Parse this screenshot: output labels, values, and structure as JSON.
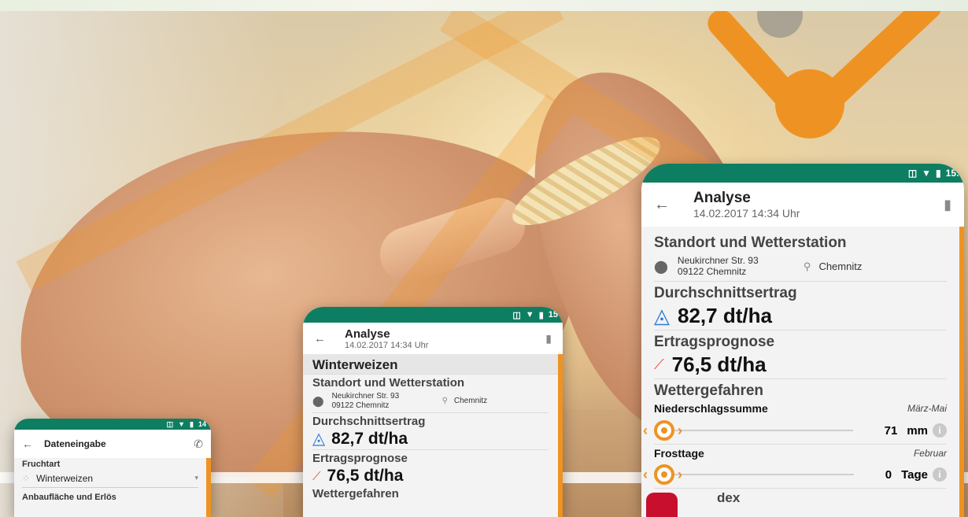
{
  "phone_main": {
    "status_time": "15:",
    "title": "Analyse",
    "subtitle": "14.02.2017 14:34 Uhr",
    "location_heading": "Standort und Wetterstation",
    "address_line1": "Neukirchner Str. 93",
    "address_line2": "09122 Chemnitz",
    "station": "Chemnitz",
    "yield_heading": "Durchschnittsertrag",
    "yield_value": "82,7 dt/ha",
    "forecast_heading": "Ertragsprognose",
    "forecast_value": "76,5 dt/ha",
    "hazards_heading": "Wettergefahren",
    "hazard1_label": "Niederschlagssumme",
    "hazard1_period": "März-Mai",
    "hazard1_value": "71",
    "hazard1_unit": "mm",
    "hazard2_label": "Frosttage",
    "hazard2_period": "Februar",
    "hazard2_value": "0",
    "hazard2_unit": "Tage",
    "partial_text": "dex"
  },
  "phone_middle": {
    "status_time": "15",
    "title": "Analyse",
    "subtitle": "14.02.2017 14:34 Uhr",
    "crop_heading": "Winterweizen",
    "location_heading": "Standort und Wetterstation",
    "address_line1": "Neukirchner Str. 93",
    "address_line2": "09122 Chemnitz",
    "station": "Chemnitz",
    "yield_heading": "Durchschnittsertrag",
    "yield_value": "82,7 dt/ha",
    "forecast_heading": "Ertragsprognose",
    "forecast_value": "76,5 dt/ha",
    "hazards_heading": "Wettergefahren"
  },
  "phone_left": {
    "status_time": "14",
    "title": "Dateneingabe",
    "crop_label": "Fruchtart",
    "crop_value": "Winterweizen",
    "area_label": "Anbaufläche und Erlös"
  },
  "colors": {
    "brand_green": "#0e7e62",
    "accent_orange": "#ee9323",
    "yield_blue": "#2b7bd8",
    "forecast_red": "#e0453d"
  },
  "icons": [
    "back-arrow-icon",
    "trash-icon",
    "location-pin-icon",
    "weather-station-icon",
    "yield-curve-icon",
    "forecast-trend-icon",
    "info-icon",
    "phone-icon",
    "wheat-icon",
    "dropdown-caret-icon",
    "vibrate-icon",
    "wifi-icon",
    "battery-icon"
  ]
}
